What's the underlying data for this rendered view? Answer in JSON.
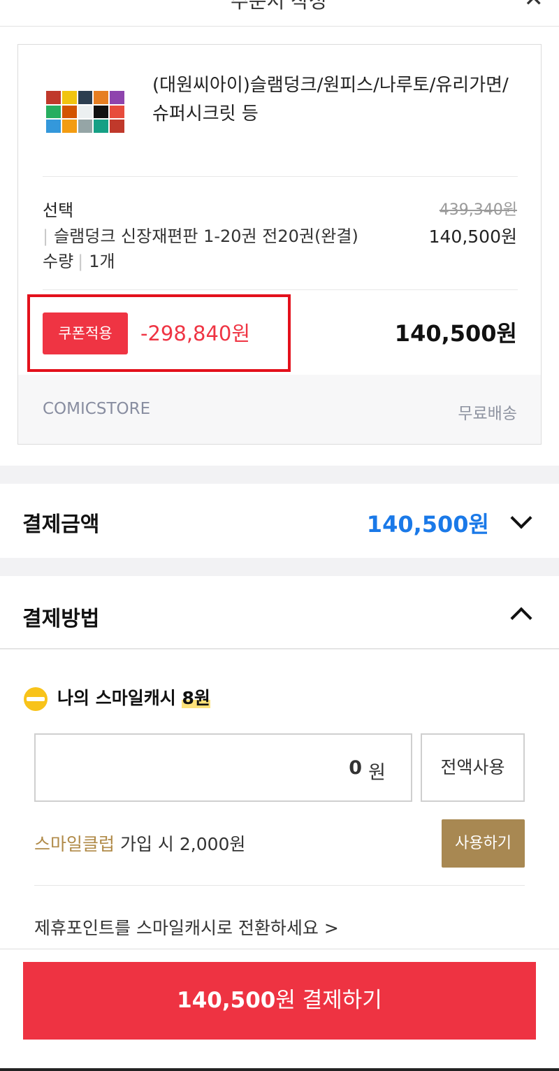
{
  "header": {
    "title": "주문서 작성",
    "close_icon": "close-icon"
  },
  "product": {
    "name": "(대원씨아이)슬램덩크/원피스/나루토/유리가면/슈퍼시크릿 등",
    "option_label": "선택",
    "option_bar": "|",
    "option_name": "슬램덩크 신장재편판 1-20권 전20권(완결)",
    "original_price": "439,340원",
    "option_price": "140,500원",
    "quantity_label": "수량",
    "quantity_bar": "|",
    "quantity_value": "1개",
    "coupon_badge": "쿠폰적용",
    "coupon_discount": "-298,840원",
    "line_total": "140,500원",
    "seller": "COMICSTORE",
    "shipping": "무료배송"
  },
  "payment_amount": {
    "label": "결제금액",
    "value": "140,500원"
  },
  "payment_method": {
    "label": "결제방법",
    "smile_cash_label": "나의 스마일캐시",
    "smile_cash_amount": "8원",
    "input_value": "0",
    "input_unit": "원",
    "use_all_label": "전액사용",
    "club_link": "스마일클럽",
    "club_text": " 가입 시 2,000원",
    "use_button": "사용하기",
    "convert_points": "제휴포인트를 스마일캐시로 전환하세요 >"
  },
  "checkout": {
    "amount": "140,500",
    "suffix": "원 결제하기"
  },
  "colors": {
    "accent_red": "#ee3342",
    "price_blue": "#1a79e8",
    "club_gold": "#a88852",
    "smile_yellow": "#f8c31a"
  }
}
